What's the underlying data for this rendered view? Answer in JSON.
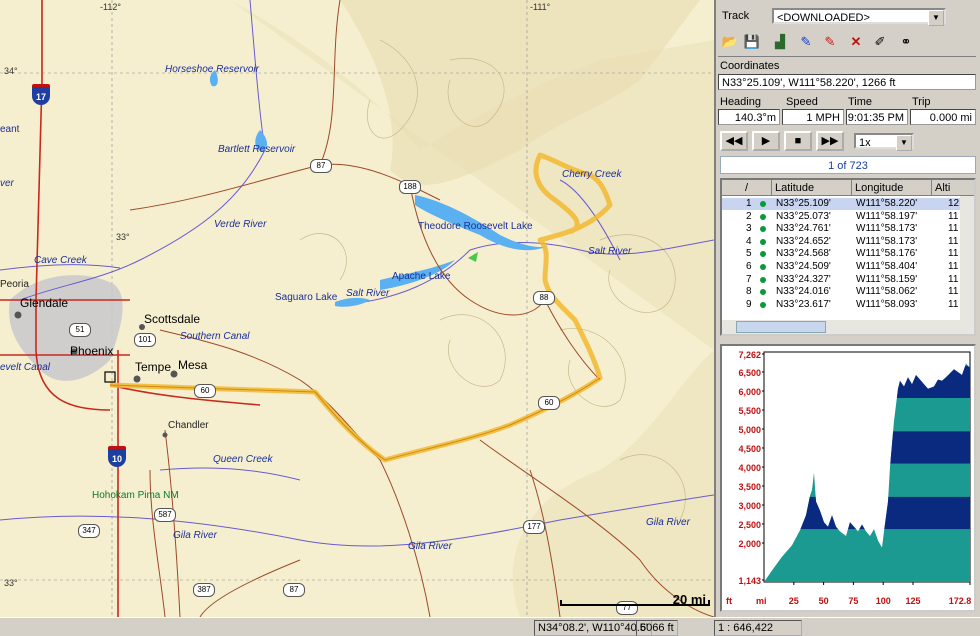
{
  "map": {
    "grid_labels": {
      "lon_112": "-112°",
      "lon_111": "-111°",
      "lat_34": "34°",
      "lat_33": "33°",
      "lat_left": "33°"
    },
    "water_labels": [
      "Horseshoe Reservoir",
      "Bartlett Reservoir",
      "Verde River",
      "Cave Creek",
      "Theodore Roosevelt Lake",
      "Cherry Creek",
      "Salt River",
      "Apache Lake",
      "Saguaro Lake",
      "Salt River",
      "Southern Canal",
      "Queen Creek",
      "Gila River",
      "Gila River",
      "Gila River",
      "evelt Canal",
      "ver",
      "eant"
    ],
    "cities": [
      "Peoria",
      "Glendale",
      "Scottsdale",
      "Phoenix",
      "Tempe",
      "Mesa",
      "Chandler"
    ],
    "park": "Hohokam Pima NM",
    "highways": [
      "17",
      "10"
    ],
    "routes": [
      "87",
      "188",
      "88",
      "51",
      "101",
      "60",
      "60",
      "587",
      "347",
      "387",
      "87",
      "177",
      "77"
    ],
    "scale_label": "20 mi"
  },
  "panel": {
    "track_label": "Track",
    "track_value": "<DOWNLOADED>",
    "toolbar_icons": [
      "open-folder-icon",
      "save-disk-icon",
      "elevation-profile-icon",
      "pen-blue-icon",
      "pen-red-icon",
      "delete-x-icon",
      "edit-pencil-icon",
      "binoculars-icon"
    ],
    "coordinates_label": "Coordinates",
    "coordinates_value": "N33°25.109',  W111°58.220',  1266 ft",
    "heading_label": "Heading",
    "speed_label": "Speed",
    "time_label": "Time",
    "trip_label": "Trip",
    "heading_value": "140.3°m",
    "speed_value": "1 MPH",
    "time_value": "9:01:35 PM",
    "trip_value": "0.000 mi",
    "playback": {
      "rewind": "◀◀",
      "play": "▶",
      "stop": "■",
      "forward": "▶▶",
      "speed": "1x"
    },
    "point_count": "1 of 723",
    "table": {
      "columns": [
        "/",
        "Latitude",
        "Longitude",
        "Alti"
      ],
      "rows": [
        {
          "n": "1",
          "lat": "N33°25.109'",
          "lon": "W111°58.220'",
          "alt": "12"
        },
        {
          "n": "2",
          "lat": "N33°25.073'",
          "lon": "W111°58.197'",
          "alt": "11"
        },
        {
          "n": "3",
          "lat": "N33°24.761'",
          "lon": "W111°58.173'",
          "alt": "11"
        },
        {
          "n": "4",
          "lat": "N33°24.652'",
          "lon": "W111°58.173'",
          "alt": "11"
        },
        {
          "n": "5",
          "lat": "N33°24.568'",
          "lon": "W111°58.176'",
          "alt": "11"
        },
        {
          "n": "6",
          "lat": "N33°24.509'",
          "lon": "W111°58.404'",
          "alt": "11"
        },
        {
          "n": "7",
          "lat": "N33°24.327'",
          "lon": "W111°58.159'",
          "alt": "11"
        },
        {
          "n": "8",
          "lat": "N33°24.016'",
          "lon": "W111°58.062'",
          "alt": "11"
        },
        {
          "n": "9",
          "lat": "N33°23.617'",
          "lon": "W111°58.093'",
          "alt": "11"
        }
      ]
    },
    "profile": {
      "y_ticks": [
        "7,262",
        "6,500",
        "6,000",
        "5,500",
        "5,000",
        "4,500",
        "4,000",
        "3,500",
        "3,000",
        "2,500",
        "2,000",
        "1,143"
      ],
      "y_unit": "ft",
      "x_ticks": [
        "25",
        "50",
        "75",
        "100",
        "125",
        "172.8"
      ],
      "x_unit": "mi",
      "colors": {
        "dark": "#0a2a80",
        "teal": "#1a9a90"
      }
    }
  },
  "status": {
    "coords": "N34°08.2', W110°40.5'",
    "elevation": "6066 ft",
    "scale": "1 : 646,422"
  }
}
